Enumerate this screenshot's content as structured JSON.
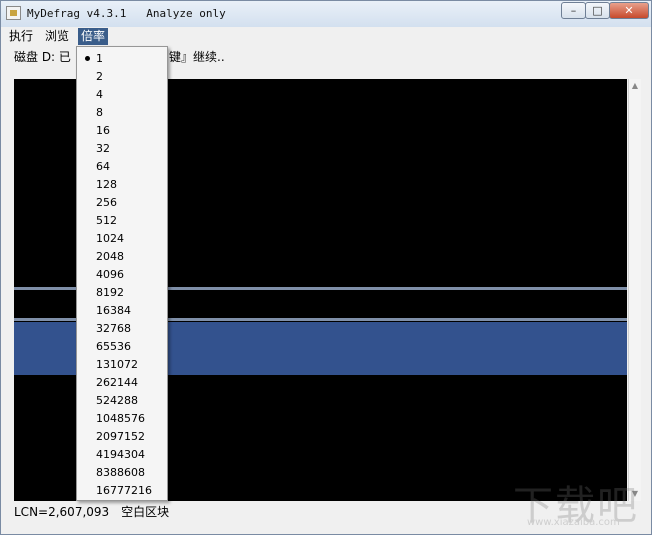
{
  "window": {
    "app_name": "MyDefrag v4.3.1",
    "mode": "Analyze only",
    "controls": {
      "minimize": "–",
      "maximize": "□",
      "close": "✕"
    }
  },
  "menubar": {
    "items": [
      {
        "label": "执行"
      },
      {
        "label": "浏览"
      },
      {
        "label": "倍率",
        "active": true
      }
    ]
  },
  "status": {
    "disk_label": "磁盘 D:  已",
    "tail": "键』继续.."
  },
  "zoom_menu": {
    "selected": "1",
    "options": [
      "1",
      "2",
      "4",
      "8",
      "16",
      "32",
      "64",
      "128",
      "256",
      "512",
      "1024",
      "2048",
      "4096",
      "8192",
      "16384",
      "32768",
      "65536",
      "131072",
      "262144",
      "524288",
      "1048576",
      "2097152",
      "4194304",
      "8388608",
      "16777216"
    ]
  },
  "footer": {
    "lcn": "LCN=2,607,093",
    "block_label": "空白区块"
  },
  "watermark": {
    "logo_text": "下载吧",
    "url": "www.xiazaiba.com"
  },
  "colors": {
    "diskmap_bg": "#000000",
    "used_block": "#33528e",
    "thin_stripe": "#7f8fa8",
    "menu_highlight": "#3a5d8a"
  }
}
